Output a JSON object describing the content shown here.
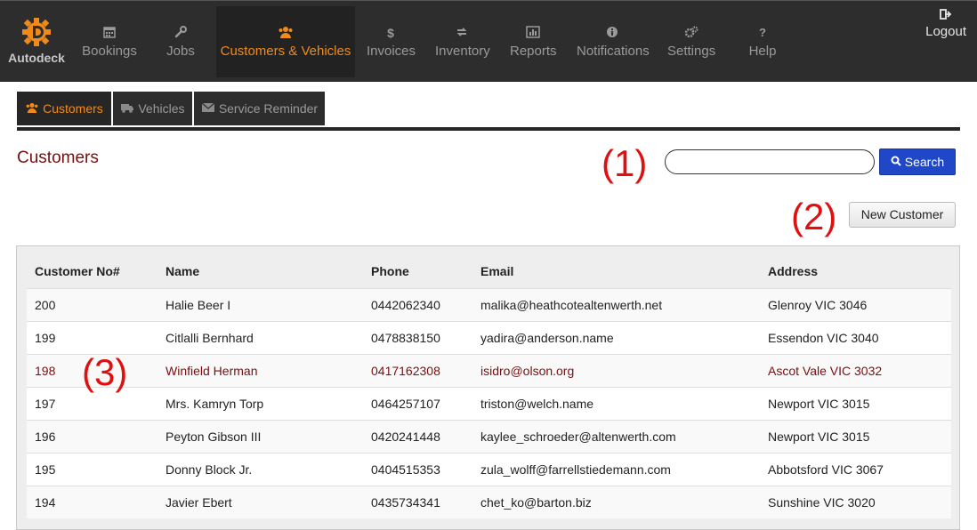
{
  "app": {
    "logo_text": "Autodeck"
  },
  "nav": {
    "items": [
      {
        "label": "Bookings",
        "icon": "calendar-icon"
      },
      {
        "label": "Jobs",
        "icon": "wrench-icon"
      },
      {
        "label": "Customers & Vehicles",
        "icon": "users-icon",
        "active": true
      },
      {
        "label": "Invoices",
        "icon": "dollar-icon"
      },
      {
        "label": "Inventory",
        "icon": "refresh-icon"
      },
      {
        "label": "Reports",
        "icon": "chart-icon"
      },
      {
        "label": "Notifications",
        "icon": "info-icon"
      },
      {
        "label": "Settings",
        "icon": "cogs-icon"
      },
      {
        "label": "Help",
        "icon": "question-icon"
      }
    ],
    "logout": "Logout"
  },
  "subtabs": [
    {
      "label": "Customers",
      "icon": "users-icon",
      "active": true
    },
    {
      "label": "Vehicles",
      "icon": "truck-icon"
    },
    {
      "label": "Service Reminder",
      "icon": "envelope-icon"
    }
  ],
  "page": {
    "title": "Customers",
    "search_value": "",
    "search_button": "Search",
    "new_button": "New Customer",
    "markers": [
      "(1)",
      "(2)",
      "(3)"
    ]
  },
  "table": {
    "columns": [
      "Customer No#",
      "Name",
      "Phone",
      "Email",
      "Address"
    ],
    "rows": [
      [
        "200",
        "Halie Beer I",
        "0442062340",
        "malika@heathcotealtenwerth.net",
        "Glenroy VIC 3046"
      ],
      [
        "199",
        "Citlalli Bernhard",
        "0478838150",
        "yadira@anderson.name",
        "Essendon VIC 3040"
      ],
      [
        "198",
        "Winfield Herman",
        "0417162308",
        "isidro@olson.org",
        "Ascot Vale VIC 3032"
      ],
      [
        "197",
        "Mrs. Kamryn Torp",
        "0464257107",
        "triston@welch.name",
        "Newport VIC 3015"
      ],
      [
        "196",
        "Peyton Gibson III",
        "0420241448",
        "kaylee_schroeder@altenwerth.com",
        "Newport VIC 3015"
      ],
      [
        "195",
        "Donny Block Jr.",
        "0404515353",
        "zula_wolff@farrellstiedemann.com",
        "Abbotsford VIC 3067"
      ],
      [
        "194",
        "Javier Ebert",
        "0435734341",
        "chet_ko@barton.biz",
        "Sunshine VIC 3020"
      ]
    ],
    "highlighted_row": 2
  },
  "colors": {
    "accent": "#f08a1c",
    "title": "#7a0f0f",
    "search_button": "#1f47c7",
    "marker": "#e01010"
  }
}
